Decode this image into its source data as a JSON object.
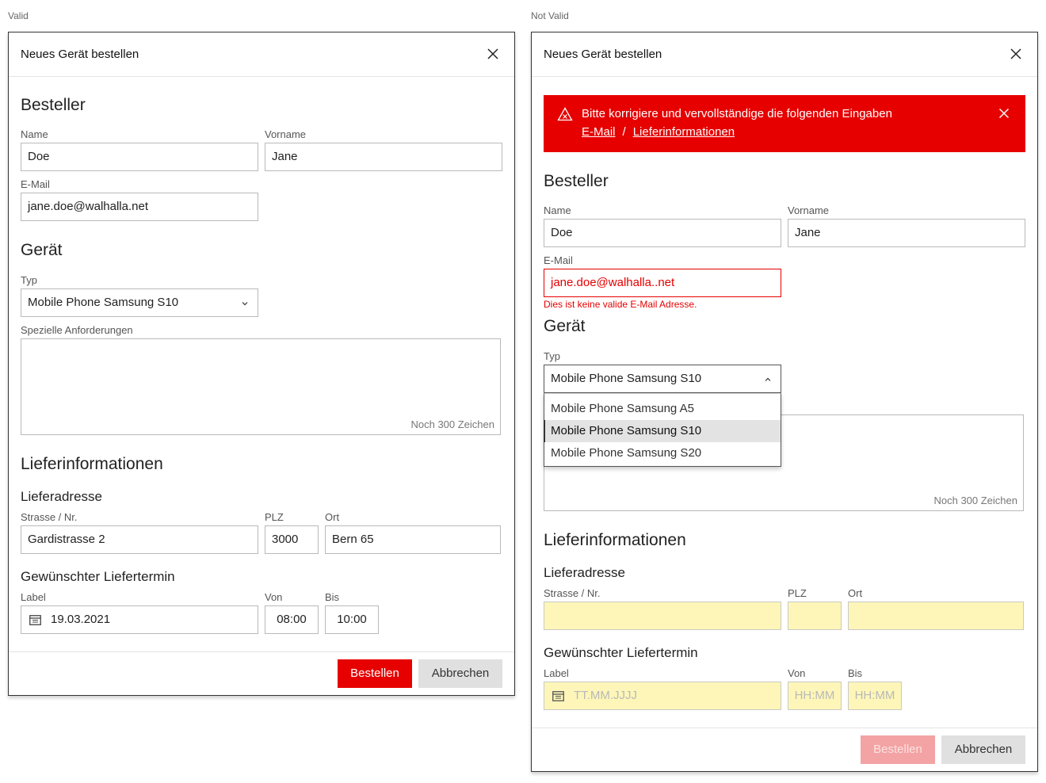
{
  "captions": {
    "valid": "Valid",
    "invalid": "Not Valid"
  },
  "dialog": {
    "title": "Neues Gerät bestellen",
    "sections": {
      "orderer": "Besteller",
      "device": "Gerät",
      "delivery": "Lieferinformationen",
      "address": "Lieferadresse",
      "date": "Gewünschter Liefertermin"
    },
    "labels": {
      "name": "Name",
      "firstname": "Vorname",
      "email": "E-Mail",
      "type": "Typ",
      "requirements": "Spezielle Anforderungen",
      "street": "Strasse / Nr.",
      "zip": "PLZ",
      "city": "Ort",
      "date": "Label",
      "from": "Von",
      "to": "Bis"
    },
    "buttons": {
      "order": "Bestellen",
      "cancel": "Abbrechen"
    }
  },
  "valid": {
    "name": "Doe",
    "firstname": "Jane",
    "email": "jane.doe@walhalla.net",
    "type": "Mobile Phone Samsung S10",
    "counter": "Noch 300 Zeichen",
    "street": "Gardistrasse 2",
    "zip": "3000",
    "city": "Bern 65",
    "date": "19.03.2021",
    "from": "08:00",
    "to": "10:00"
  },
  "invalid": {
    "alert": {
      "message": "Bitte korrigiere und vervollständige die folgenden Eingaben",
      "links": [
        "E-Mail",
        "Lieferinformationen"
      ],
      "separator": "/"
    },
    "name": "Doe",
    "firstname": "Jane",
    "email": "jane.doe@walhalla..net",
    "email_error": "Dies ist keine valide E-Mail Adresse.",
    "type": "Mobile Phone Samsung S10",
    "options": [
      "Mobile Phone Samsung A5",
      "Mobile Phone Samsung S10",
      "Mobile Phone Samsung S20"
    ],
    "selected_option": "Mobile Phone Samsung S10",
    "counter": "Noch 300 Zeichen",
    "date_placeholder": "TT.MM.JJJJ",
    "time_placeholder": "HH:MM"
  },
  "colors": {
    "primary": "#e60000",
    "primary_disabled": "#f3a3a3",
    "missing_field": "#fdf6b8",
    "secondary_button": "#e0e0e0"
  },
  "icons": {
    "close": "close-icon",
    "chevron_down": "chevron-down-icon",
    "chevron_up": "chevron-up-icon",
    "calendar": "calendar-icon",
    "warning": "warning-icon"
  }
}
